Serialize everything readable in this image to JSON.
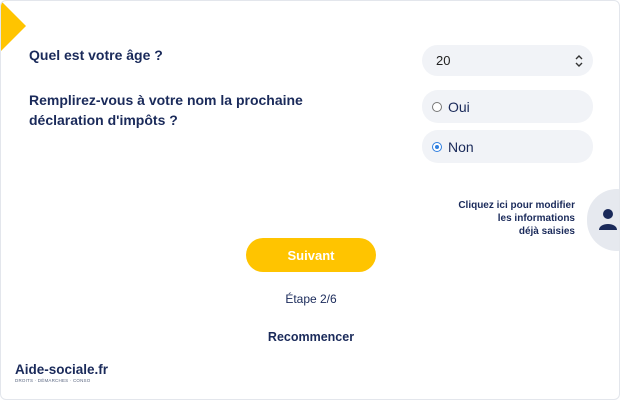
{
  "form": {
    "age_question": "Quel est votre âge ?",
    "age_value": "20",
    "tax_question": "Remplirez-vous à votre nom la prochaine déclaration d'impôts ?",
    "options": [
      {
        "label": "Oui",
        "checked": false
      },
      {
        "label": "Non",
        "checked": true
      }
    ]
  },
  "modify_link": {
    "line1": "Cliquez ici pour modifier",
    "line2": "les informations",
    "line3": "déjà saisies"
  },
  "actions": {
    "next_label": "Suivant",
    "step_text": "Étape 2/6",
    "restart_label": "Recommencer"
  },
  "brand": {
    "name": "Aide-sociale.fr",
    "tagline": "DROITS · DÉMARCHES · CONSO"
  },
  "colors": {
    "accent": "#ffc400",
    "text": "#1a2a5a",
    "field_bg": "#f1f3f7",
    "radio_selected": "#2f7fe0"
  },
  "icons": {
    "corner": "corner-flag",
    "select": "select-arrows-icon",
    "user": "user-icon"
  }
}
